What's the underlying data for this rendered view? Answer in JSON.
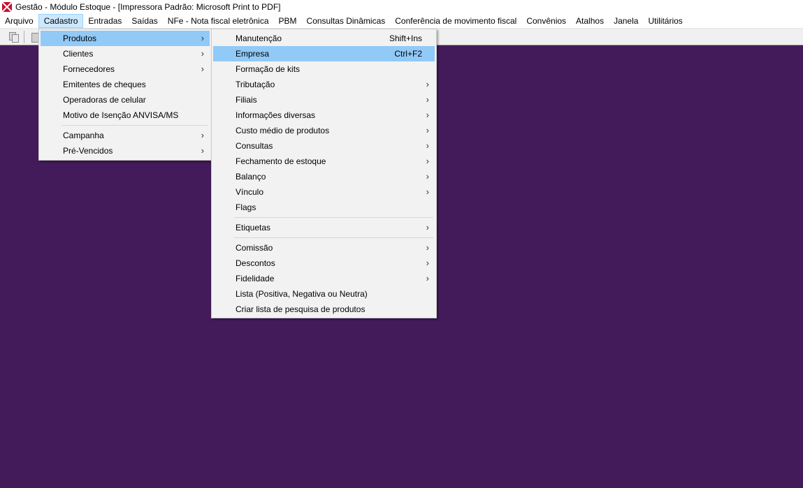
{
  "title_bar": {
    "title": "Gestão  - Módulo Estoque - [Impressora Padrão: Microsoft Print to PDF]",
    "icon": "app-logo-icon"
  },
  "menu_bar": {
    "items": [
      "Arquivo",
      "Cadastro",
      "Entradas",
      "Saídas",
      "NFe - Nota fiscal eletrônica",
      "PBM",
      "Consultas Dinâmicas",
      "Conferência de movimento fiscal",
      "Convênios",
      "Atalhos",
      "Janela",
      "Utilitários"
    ],
    "active": "Cadastro"
  },
  "cadastro_menu": {
    "items": [
      {
        "label": "Produtos",
        "submenu": true
      },
      {
        "label": "Clientes",
        "submenu": true
      },
      {
        "label": "Fornecedores",
        "submenu": true
      },
      {
        "label": "Emitentes de cheques",
        "submenu": false
      },
      {
        "label": "Operadoras de celular",
        "submenu": false
      },
      {
        "label": "Motivo de Isenção ANVISA/MS",
        "submenu": false
      },
      {
        "label": "Campanha",
        "submenu": true
      },
      {
        "label": "Pré-Vencidos",
        "submenu": true
      }
    ],
    "highlighted": "Produtos"
  },
  "produtos_menu": {
    "items": [
      {
        "label": "Manutenção",
        "shortcut": "Shift+Ins",
        "submenu": false
      },
      {
        "label": "Empresa",
        "shortcut": "Ctrl+F2",
        "submenu": false
      },
      {
        "label": "Formação de kits",
        "shortcut": "",
        "submenu": false
      },
      {
        "label": "Tributação",
        "shortcut": "",
        "submenu": true
      },
      {
        "label": "Filiais",
        "shortcut": "",
        "submenu": true
      },
      {
        "label": "Informações diversas",
        "shortcut": "",
        "submenu": true
      },
      {
        "label": "Custo médio de produtos",
        "shortcut": "",
        "submenu": true
      },
      {
        "label": "Consultas",
        "shortcut": "",
        "submenu": true
      },
      {
        "label": "Fechamento de estoque",
        "shortcut": "",
        "submenu": true
      },
      {
        "label": "Balanço",
        "shortcut": "",
        "submenu": true
      },
      {
        "label": "Vínculo",
        "shortcut": "",
        "submenu": true
      },
      {
        "label": "Flags",
        "shortcut": "",
        "submenu": false
      },
      {
        "label": "Etiquetas",
        "shortcut": "",
        "submenu": true
      },
      {
        "label": "Comissão",
        "shortcut": "",
        "submenu": true
      },
      {
        "label": "Descontos",
        "shortcut": "",
        "submenu": true
      },
      {
        "label": "Fidelidade",
        "shortcut": "",
        "submenu": true
      },
      {
        "label": "Lista (Positiva, Negativa ou Neutra)",
        "shortcut": "",
        "submenu": false
      },
      {
        "label": "Criar lista de pesquisa de produtos",
        "shortcut": "",
        "submenu": false
      }
    ],
    "highlighted": "Empresa"
  },
  "submenu_arrow": "›",
  "colors": {
    "workspace": "#441b5a",
    "menu_highlight": "#91c9f7",
    "menubar_active": "#cce8ff"
  }
}
